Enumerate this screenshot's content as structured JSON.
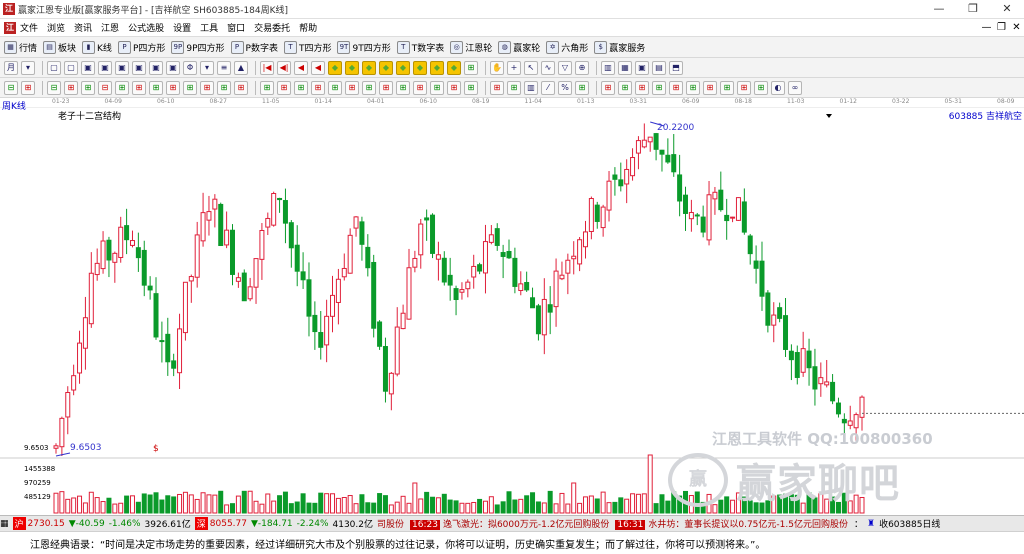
{
  "window": {
    "title": "赢家江恩专业版[赢家服务平台] - [吉祥航空  SH603885-184周K线]",
    "app_icon": "江",
    "controls": [
      "—",
      "❐",
      "✕"
    ]
  },
  "menu": {
    "items": [
      "文件",
      "浏览",
      "资讯",
      "江恩",
      "公式选股",
      "设置",
      "工具",
      "窗口",
      "交易委托",
      "帮助"
    ],
    "controls": [
      "—",
      "❐",
      "✕"
    ]
  },
  "toolbar": {
    "buttons": [
      {
        "icon": "▦",
        "label": "行情"
      },
      {
        "icon": "▤",
        "label": "板块"
      },
      {
        "icon": "▮",
        "label": "K线"
      },
      {
        "icon": "P",
        "label": "P四方形"
      },
      {
        "icon": "9P",
        "label": "9P四方形"
      },
      {
        "icon": "P",
        "label": "P数字表"
      },
      {
        "icon": "T",
        "label": "T四方形"
      },
      {
        "icon": "9T",
        "label": "9T四方形"
      },
      {
        "icon": "T",
        "label": "T数字表"
      },
      {
        "icon": "◎",
        "label": "江恩轮"
      },
      {
        "icon": "◍",
        "label": "赢家轮"
      },
      {
        "icon": "✡",
        "label": "六角形"
      },
      {
        "icon": "$",
        "label": "赢家服务"
      }
    ]
  },
  "toolbar2_icons": [
    "月",
    "▾",
    "▢",
    "▢",
    "▣",
    "▣",
    "▣",
    "▣",
    "▣",
    "▣",
    "Φ",
    "▾",
    "≡",
    "▲",
    "|◀",
    "◀|",
    "◀",
    "◀",
    "◆",
    "◆",
    "◆",
    "◆",
    "◆",
    "◆",
    "◆",
    "◆",
    "⊞",
    "✋",
    "+",
    "↖",
    "∿",
    "▽",
    "⊕",
    "▥",
    "▦",
    "▣",
    "▤",
    "⬒"
  ],
  "toolbar3_icons": [
    "⊟",
    "⊞",
    "⊟",
    "⊞",
    "⊞",
    "⊟",
    "⊞",
    "⊞",
    "⊞",
    "⊞",
    "⊞",
    "⊞",
    "⊞",
    "⊞",
    "⊞",
    "⊞",
    "⊞",
    "⊞",
    "⊞",
    "⊞",
    "⊞",
    "⊞",
    "⊞",
    "⊞",
    "⊞",
    "⊞",
    "⊞",
    "⊞",
    "⊞",
    "▥",
    "⁄",
    "%",
    "⊞",
    "⊞",
    "⊞",
    "⊞",
    "⊞",
    "⊞",
    "⊞",
    "⊞",
    "⊞",
    "⊞",
    "⊞",
    "◐",
    "∞"
  ],
  "chart": {
    "period_label": "周K线",
    "subtitle": "老子十二宫结构",
    "stock_label": "603885 吉祥航空",
    "dates": [
      "01-23",
      "04-09",
      "06-10",
      "08-27",
      "11-05",
      "01-14",
      "04-01",
      "06-10",
      "08-19",
      "11-04",
      "01-13",
      "03-31",
      "06-09",
      "08-18",
      "11-03",
      "01-12",
      "03-22",
      "05-31",
      "08-09"
    ],
    "high_label": "20.2200",
    "low_label": "9.6503",
    "low_axis_label": "9.6503",
    "dollar_mark": "$",
    "vol_axis": [
      "1455388",
      "970259",
      "485129"
    ],
    "up_color": "#e0203a",
    "down_color": "#0a9a2a"
  },
  "chart_data": {
    "type": "candlestick",
    "period": "weekly",
    "high": 20.22,
    "low": 9.6503,
    "last_close_approx": 11.0,
    "volume_ticks": [
      1455388,
      970259,
      485129
    ]
  },
  "watermark": {
    "line1": "江恩工具软件 QQ:100800360",
    "logo": "赢",
    "line2": "赢家聊吧"
  },
  "status": {
    "sh_badge": "沪",
    "sh_index": "2730.15",
    "sh_change": "▼-40.59",
    "sh_pct": "-1.46%",
    "sh_amount": "3926.61亿",
    "sz_badge": "深",
    "sz_index": "8055.77",
    "sz_change": "▼-184.71",
    "sz_pct": "-2.24%",
    "sz_amount": "4130.2亿",
    "news1": "司股份",
    "news2_time": "16:23",
    "news2": "逸飞激光：拟6000万元-1.2亿元回购股份",
    "news3_time": "16:31",
    "news3": "水井坊：董事长提议以0.75亿元-1.5亿元回购股份",
    "colon": "：",
    "bell_icon": "♜",
    "right_text": "收603885日线"
  },
  "quote": {
    "text": "江恩经典语录：“时间是决定市场走势的重要因素，经过详细研究大市及个别股票的过往记录，你将可以证明，历史确实重复发生；而了解过往，你将可以预测将来。”。"
  }
}
